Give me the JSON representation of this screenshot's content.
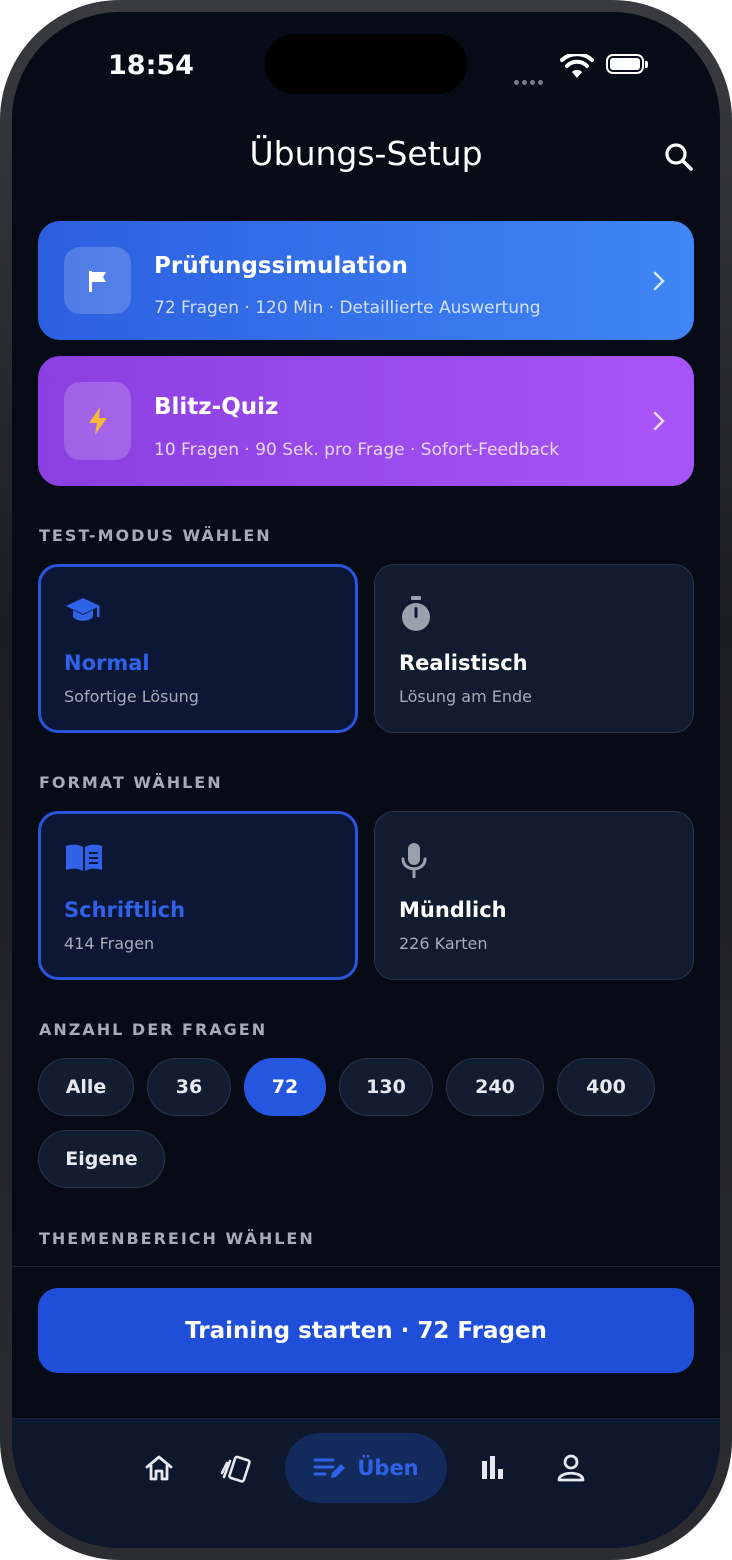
{
  "status_bar": {
    "time": "18:54"
  },
  "header": {
    "title": "Übungs-Setup"
  },
  "modes": [
    {
      "title": "Prüfungssimulation",
      "subtitle": "72 Fragen · 120 Min · Detaillierte Auswertung",
      "icon": "flag-icon",
      "color": "#3b7bf0"
    },
    {
      "title": "Blitz-Quiz",
      "subtitle": "10 Fragen · 90 Sek. pro Frage · Sofort-Feedback",
      "icon": "lightning-icon",
      "color": "#a855f7"
    }
  ],
  "test_mode": {
    "label": "TEST-MODUS WÄHLEN",
    "options": [
      {
        "title": "Normal",
        "subtitle": "Sofortige Lösung",
        "icon": "graduation-cap-icon",
        "selected": true
      },
      {
        "title": "Realistisch",
        "subtitle": "Lösung am Ende",
        "icon": "stopwatch-icon",
        "selected": false
      }
    ]
  },
  "format": {
    "label": "FORMAT WÄHLEN",
    "options": [
      {
        "title": "Schriftlich",
        "subtitle": "414 Fragen",
        "icon": "book-icon",
        "selected": true
      },
      {
        "title": "Mündlich",
        "subtitle": "226 Karten",
        "icon": "microphone-icon",
        "selected": false
      }
    ]
  },
  "question_count": {
    "label": "ANZAHL DER FRAGEN",
    "options": [
      "Alle",
      "36",
      "72",
      "130",
      "240",
      "400",
      "Eigene"
    ],
    "selected": "72"
  },
  "topic": {
    "label": "THEMENBEREICH WÄHLEN"
  },
  "cta": {
    "label": "Training starten · 72 Fragen"
  },
  "tabbar": {
    "items": [
      {
        "icon": "home-icon"
      },
      {
        "icon": "cards-icon"
      },
      {
        "icon": "practice-icon",
        "label": "Üben",
        "active": true
      },
      {
        "icon": "stats-icon"
      },
      {
        "icon": "profile-icon"
      }
    ]
  },
  "colors": {
    "accent": "#2556e0",
    "background": "#060b16",
    "card": "#121c30"
  }
}
